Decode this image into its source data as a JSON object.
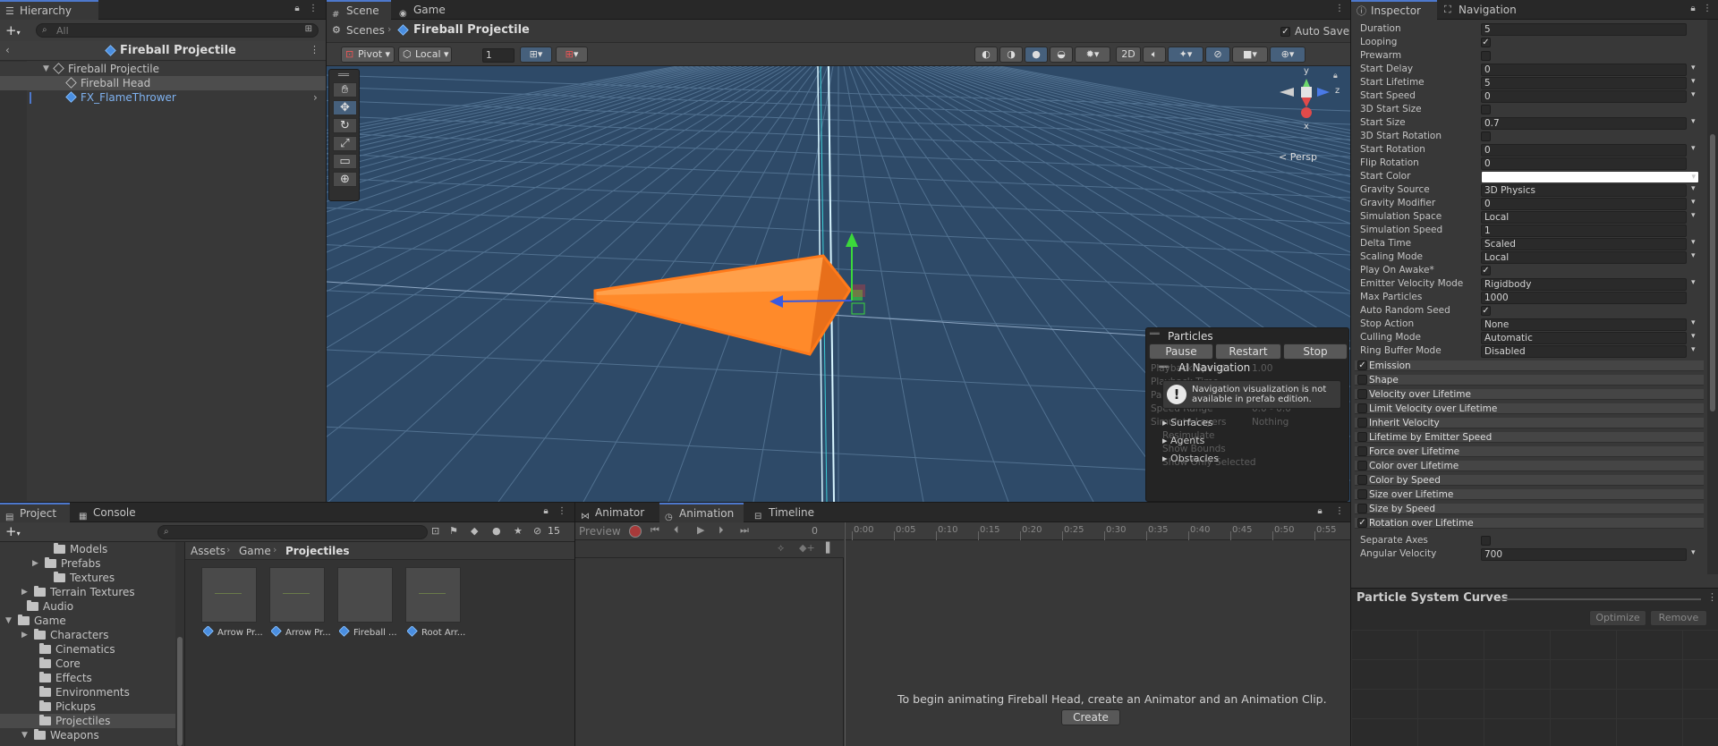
{
  "hierarchy": {
    "tab": "Hierarchy",
    "search_placeholder": "All",
    "breadcrumb": "Fireball Projectile",
    "items": [
      "Fireball Projectile",
      "Fireball Head",
      "FX_FlameThrower"
    ]
  },
  "scene": {
    "tabs": [
      "Scene",
      "Game"
    ],
    "breadcrumb_root": "Scenes",
    "breadcrumb_current": "Fireball Projectile",
    "auto_save": "Auto Save",
    "pivot": "Pivot",
    "local": "Local",
    "snap_value": "1",
    "mode_2d": "2D",
    "persp": "< Persp",
    "gizmo_axes": [
      "y",
      "z",
      "x"
    ]
  },
  "particles": {
    "title": "Particles",
    "pause": "Pause",
    "restart": "Restart",
    "stop": "Stop",
    "ai_title": "AI Navigation",
    "notice": "Navigation visualization is not available in prefab edition.",
    "sections": [
      "Surfaces",
      "Agents",
      "Obstacles"
    ],
    "faded": [
      "Playback Speed",
      "Playback Time",
      "Particles",
      "Speed Range",
      "Simulate Layers",
      "Resimulate",
      "Show Bounds",
      "Show Only Selected"
    ],
    "faded_values": [
      "1.00",
      "0.0 - 0.0",
      "Nothing"
    ]
  },
  "inspector": {
    "tabs": [
      "Inspector",
      "Navigation"
    ],
    "props": [
      {
        "label": "Duration",
        "type": "field",
        "value": "5"
      },
      {
        "label": "Looping",
        "type": "check",
        "value": "✓"
      },
      {
        "label": "Prewarm",
        "type": "check",
        "value": ""
      },
      {
        "label": "Start Delay",
        "type": "dd",
        "value": "0"
      },
      {
        "label": "Start Lifetime",
        "type": "dd",
        "value": "5"
      },
      {
        "label": "Start Speed",
        "type": "dd",
        "value": "0"
      },
      {
        "label": "3D Start Size",
        "type": "check",
        "value": ""
      },
      {
        "label": "Start Size",
        "type": "dd",
        "value": "0.7"
      },
      {
        "label": "3D Start Rotation",
        "type": "check",
        "value": ""
      },
      {
        "label": "Start Rotation",
        "type": "dd",
        "value": "0"
      },
      {
        "label": "Flip Rotation",
        "type": "field",
        "value": "0"
      },
      {
        "label": "Start Color",
        "type": "color",
        "value": ""
      },
      {
        "label": "Gravity Source",
        "type": "dd",
        "value": "3D Physics"
      },
      {
        "label": "Gravity Modifier",
        "type": "dd",
        "value": "0"
      },
      {
        "label": "Simulation Space",
        "type": "dd",
        "value": "Local"
      },
      {
        "label": "Simulation Speed",
        "type": "field",
        "value": "1"
      },
      {
        "label": "Delta Time",
        "type": "dd",
        "value": "Scaled"
      },
      {
        "label": "Scaling Mode",
        "type": "dd",
        "value": "Local"
      },
      {
        "label": "Play On Awake*",
        "type": "check",
        "value": "✓"
      },
      {
        "label": "Emitter Velocity Mode",
        "type": "dd",
        "value": "Rigidbody"
      },
      {
        "label": "Max Particles",
        "type": "field",
        "value": "1000"
      },
      {
        "label": "Auto Random Seed",
        "type": "check",
        "value": "✓"
      },
      {
        "label": "Stop Action",
        "type": "dd",
        "value": "None"
      },
      {
        "label": "Culling Mode",
        "type": "dd",
        "value": "Automatic"
      },
      {
        "label": "Ring Buffer Mode",
        "type": "dd",
        "value": "Disabled"
      }
    ],
    "modules": [
      {
        "label": "Emission",
        "checked": "✓"
      },
      {
        "label": "Shape",
        "checked": ""
      },
      {
        "label": "Velocity over Lifetime",
        "checked": ""
      },
      {
        "label": "Limit Velocity over Lifetime",
        "checked": ""
      },
      {
        "label": "Inherit Velocity",
        "checked": ""
      },
      {
        "label": "Lifetime by Emitter Speed",
        "checked": ""
      },
      {
        "label": "Force over Lifetime",
        "checked": ""
      },
      {
        "label": "Color over Lifetime",
        "checked": ""
      },
      {
        "label": "Color by Speed",
        "checked": ""
      },
      {
        "label": "Size over Lifetime",
        "checked": ""
      },
      {
        "label": "Size by Speed",
        "checked": ""
      },
      {
        "label": "Rotation over Lifetime",
        "checked": "✓"
      }
    ],
    "rot_props": [
      {
        "label": "Separate Axes",
        "type": "check",
        "value": ""
      },
      {
        "label": "Angular Velocity",
        "type": "dd",
        "value": "700"
      }
    ],
    "curves_title": "Particle System Curves",
    "optimize": "Optimize",
    "remove": "Remove"
  },
  "project": {
    "tabs": [
      "Project",
      "Console"
    ],
    "hidden_count": "15",
    "breadcrumb": [
      "Assets",
      "Game",
      "Projectiles"
    ],
    "tree": [
      "Models",
      "Prefabs",
      "Textures",
      "Terrain Textures",
      "Audio",
      "Game",
      "Characters",
      "Cinematics",
      "Core",
      "Effects",
      "Environments",
      "Pickups",
      "Projectiles",
      "Weapons"
    ],
    "assets": [
      "Arrow Pr...",
      "Arrow Pr...",
      "Fireball ...",
      "Root Arr..."
    ]
  },
  "animation": {
    "tabs": [
      "Animator",
      "Animation",
      "Timeline"
    ],
    "preview": "Preview",
    "frame": "0",
    "ticks": [
      "0:00",
      "0:05",
      "0:10",
      "0:15",
      "0:20",
      "0:25",
      "0:30",
      "0:35",
      "0:40",
      "0:45",
      "0:50",
      "0:55"
    ],
    "message": "To begin animating Fireball Head, create an Animator and an Animation Clip.",
    "create": "Create"
  },
  "colors": {
    "accent": "#4d78cc",
    "sky": "#2e4a68",
    "fireball": "#ff8a2a",
    "selection": "#2c5d87"
  }
}
